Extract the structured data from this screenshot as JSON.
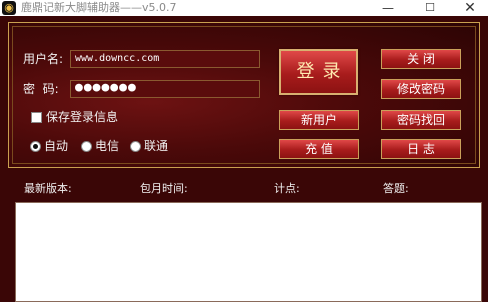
{
  "window": {
    "title": "鹿鼎记新大脚辅助器——v5.0.7",
    "minimize_glyph": "—",
    "maximize_glyph": "☐",
    "close_glyph": "✕"
  },
  "form": {
    "username_label": "用户名:",
    "username_value": "www.downcc.com",
    "password_label": "密  码:",
    "password_masked": "●●●●●●●",
    "save_login_label": "保存登录信息",
    "save_login_checked": false,
    "server_options": [
      {
        "label": "自动",
        "selected": true
      },
      {
        "label": "电信",
        "selected": false
      },
      {
        "label": "联通",
        "selected": false
      }
    ]
  },
  "buttons": {
    "login": "登录",
    "close": "关 闭",
    "change_password": "修改密码",
    "new_user": "新用户",
    "recover_password": "密码找回",
    "recharge": "充 值",
    "log": "日 志"
  },
  "status": {
    "latest_version_label": "最新版本:",
    "monthly_time_label": "包月时间:",
    "points_label": "计点:",
    "answer_label": "答题:"
  },
  "colors": {
    "frame": "#3a0606",
    "panel": "#5a0c0c",
    "button": "#c02a2a",
    "border_gold": "#c9a050"
  }
}
